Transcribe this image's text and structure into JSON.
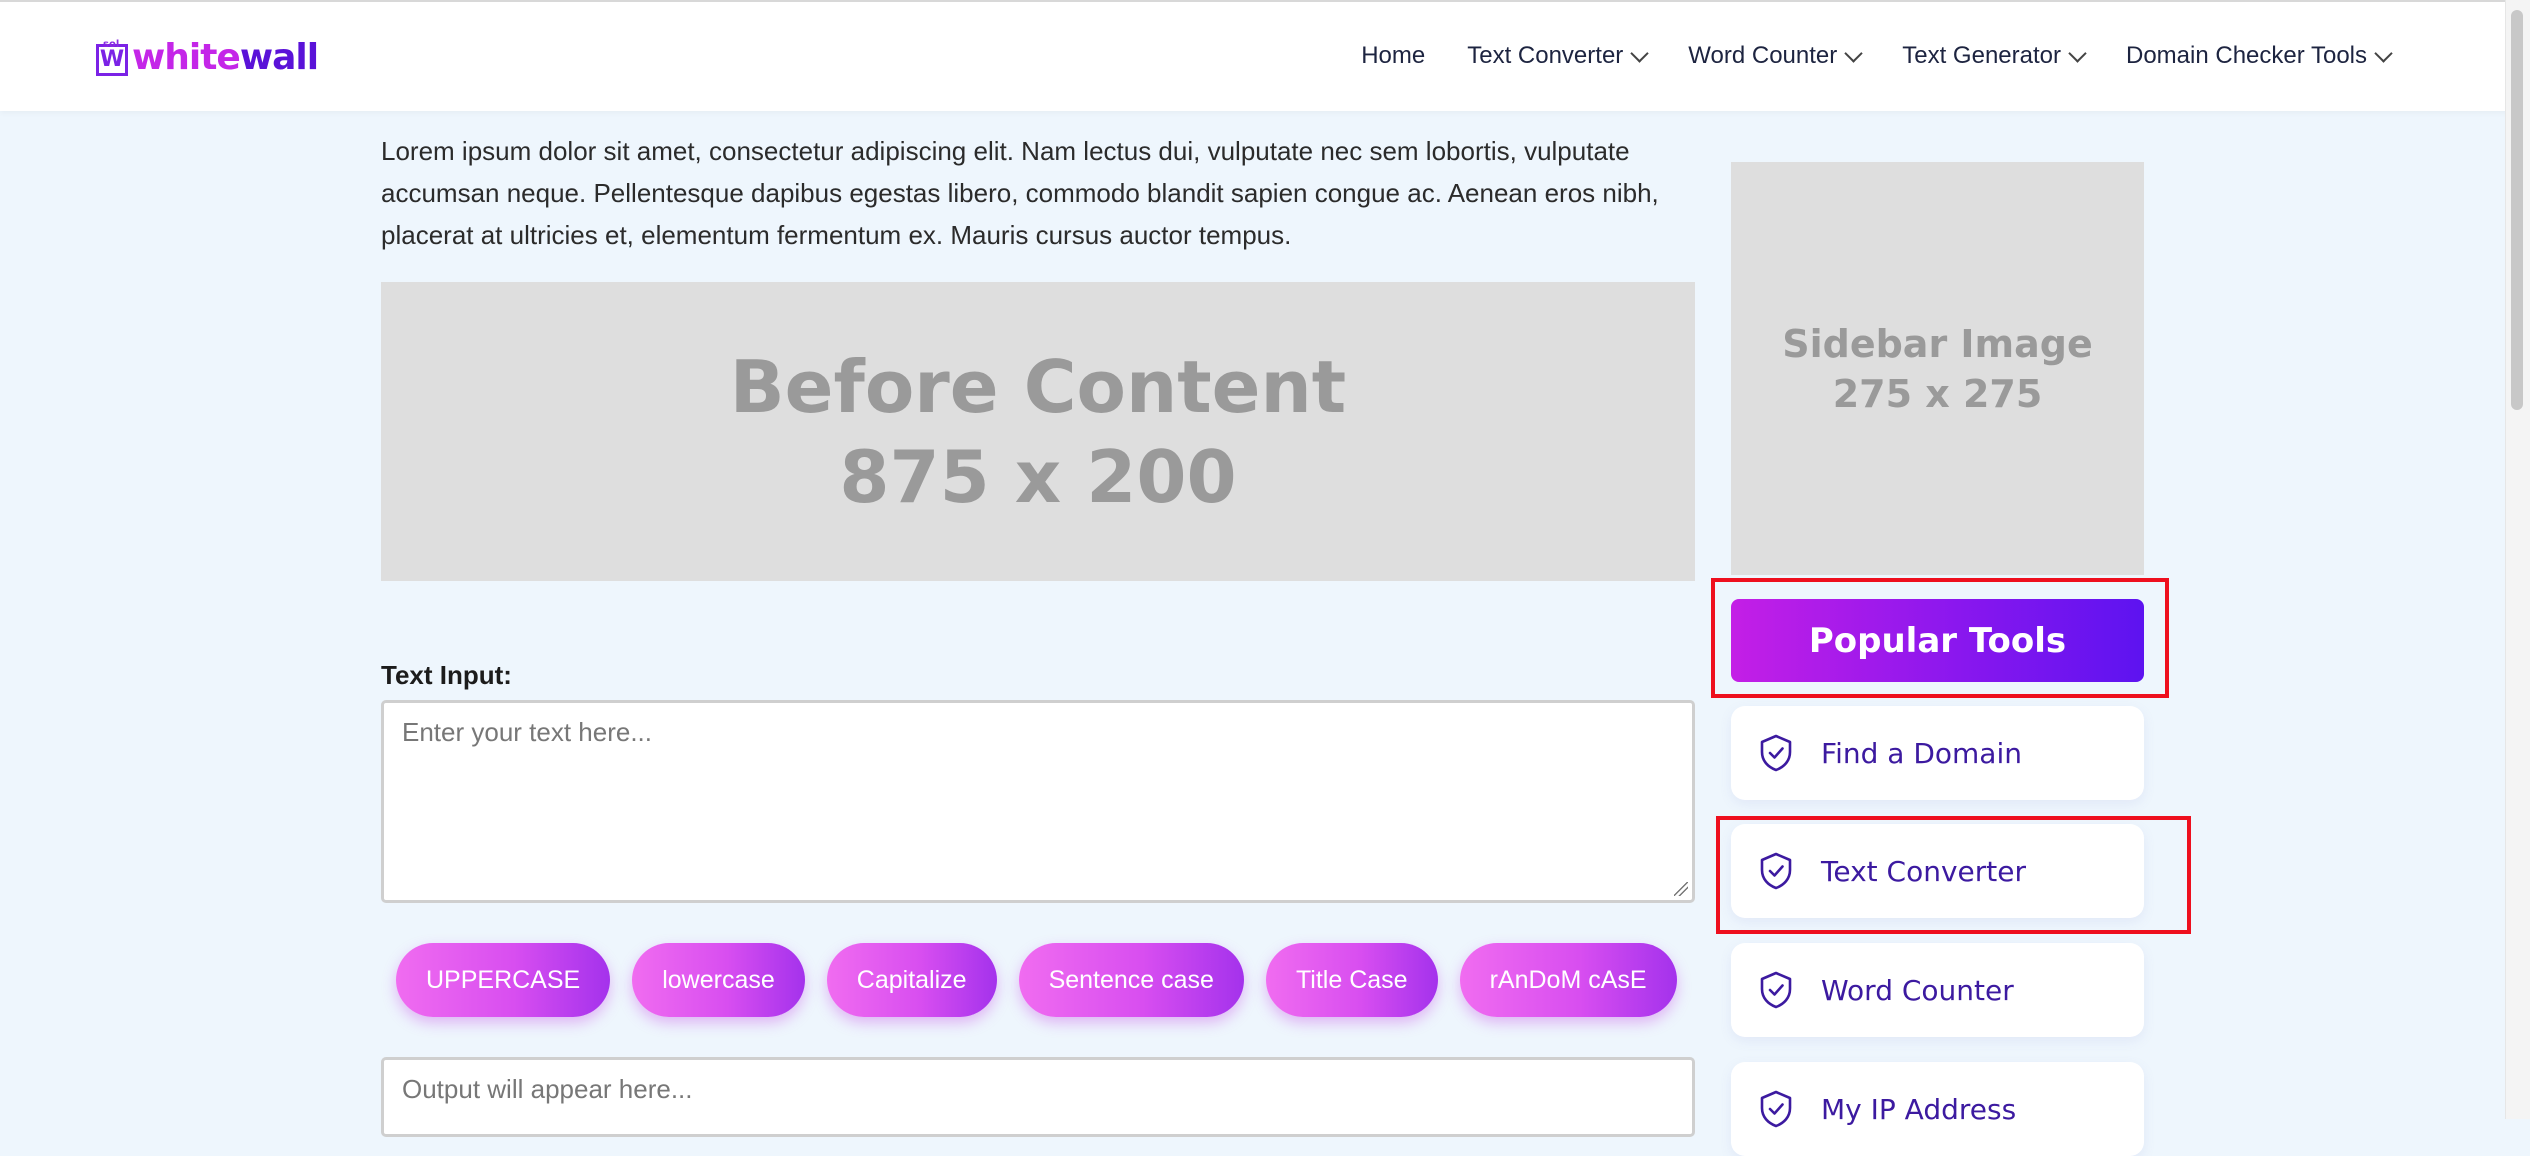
{
  "header": {
    "logo": {
      "sup": "sol",
      "mark": "W",
      "part1": "white",
      "part2": "wall"
    },
    "nav": [
      {
        "label": "Home",
        "dropdown": false
      },
      {
        "label": "Text Converter",
        "dropdown": true
      },
      {
        "label": "Word Counter",
        "dropdown": true
      },
      {
        "label": "Text Generator",
        "dropdown": true
      },
      {
        "label": "Domain Checker Tools",
        "dropdown": true
      }
    ]
  },
  "main": {
    "intro": "Lorem ipsum dolor sit amet, consectetur adipiscing elit. Nam lectus dui, vulputate nec sem lobortis, vulputate accumsan neque. Pellentesque dapibus egestas libero, commodo blandit sapien congue ac. Aenean eros nibh, placerat at ultricies et, elementum fermentum ex. Mauris cursus auctor tempus.",
    "ad_before": {
      "line1": "Before Content",
      "line2": "875 x 200"
    },
    "input_label": "Text Input:",
    "input_placeholder": "Enter your text here...",
    "buttons": [
      "UPPERCASE",
      "lowercase",
      "Capitalize",
      "Sentence case",
      "Title Case",
      "rAnDoM cAsE"
    ],
    "output_placeholder": "Output will appear here..."
  },
  "sidebar": {
    "ad": {
      "line1": "Sidebar Image",
      "line2": "275 x 275"
    },
    "popular_title": "Popular Tools",
    "tools": [
      {
        "label": "Find a Domain",
        "icon": "shield-check-icon"
      },
      {
        "label": "Text Converter",
        "icon": "shield-check-icon"
      },
      {
        "label": "Word Counter",
        "icon": "shield-check-icon"
      },
      {
        "label": "My IP Address",
        "icon": "shield-check-icon"
      }
    ]
  },
  "colors": {
    "page_bg": "#eef6fd",
    "brand_pink": "#c426e8",
    "brand_purple": "#5a12d8",
    "highlight_red": "#ee0f1e"
  }
}
